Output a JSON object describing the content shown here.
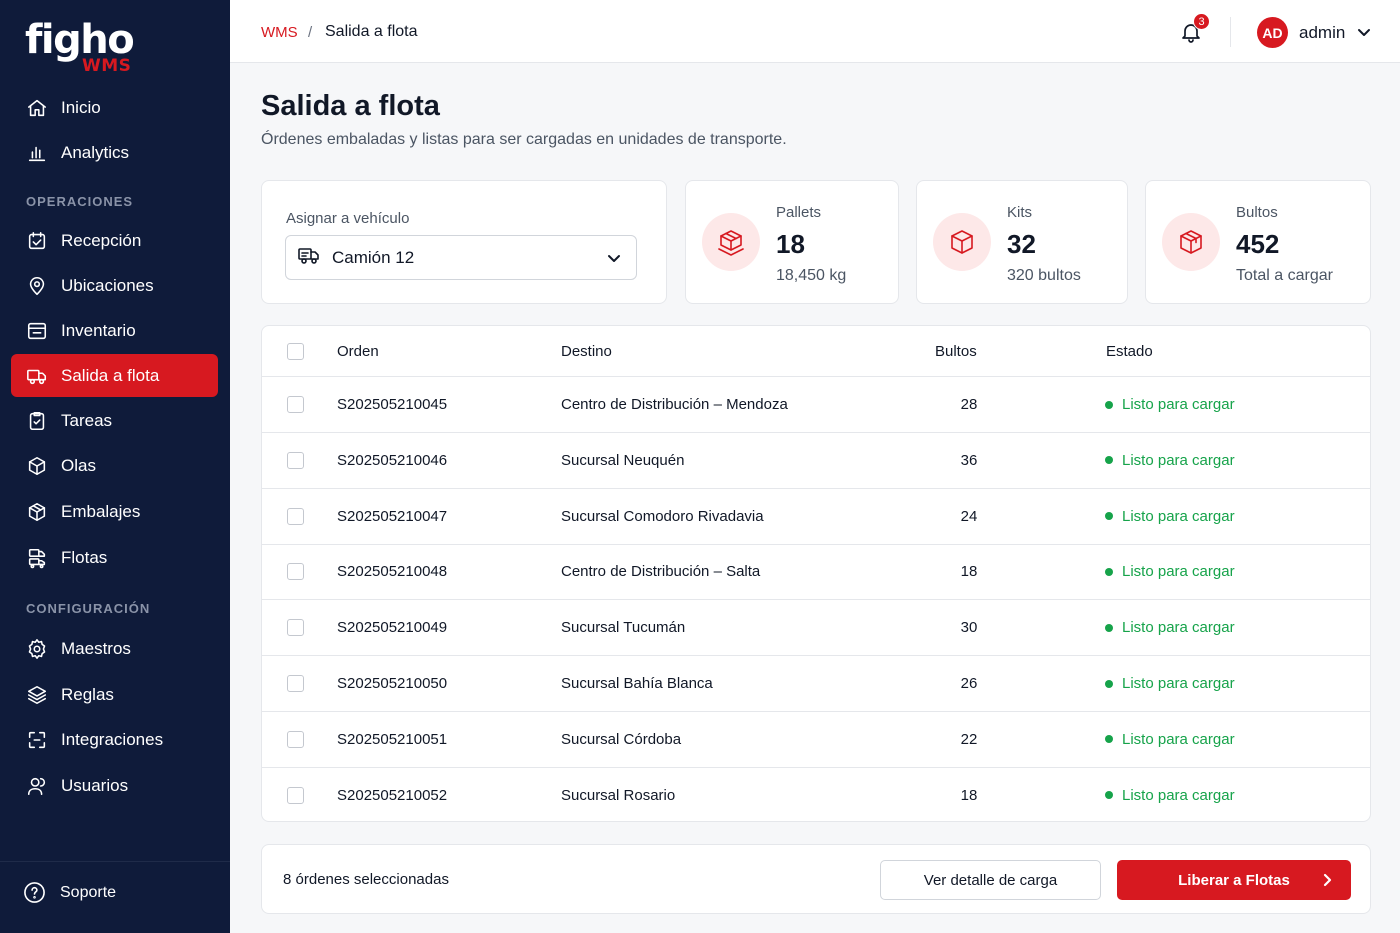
{
  "brand": {
    "name": "figho",
    "sub": "WMS",
    "accent": "#d71920",
    "sidebar_bg": "#0f1b3a"
  },
  "sidebar": {
    "top_items": [
      {
        "label": "Inicio",
        "icon": "home-icon"
      },
      {
        "label": "Analytics",
        "icon": "bar-chart-icon"
      }
    ],
    "sections": [
      {
        "title": "OPERACIONES",
        "items": [
          {
            "label": "Recepción",
            "icon": "receiving-icon"
          },
          {
            "label": "Ubicaciones",
            "icon": "map-pin-icon"
          },
          {
            "label": "Inventario",
            "icon": "inventory-icon"
          },
          {
            "label": "Salida a flota",
            "icon": "truck-icon",
            "active": true
          },
          {
            "label": "Tareas",
            "icon": "clipboard-check-icon"
          },
          {
            "label": "Olas",
            "icon": "box-icon"
          },
          {
            "label": "Embalajes",
            "icon": "package-icon"
          },
          {
            "label": "Flotas",
            "icon": "fleet-icon"
          }
        ]
      },
      {
        "title": "CONFIGURACIÓN",
        "items": [
          {
            "label": "Maestros",
            "icon": "gear-icon"
          },
          {
            "label": "Reglas",
            "icon": "rules-icon"
          },
          {
            "label": "Integraciones",
            "icon": "integrations-icon"
          },
          {
            "label": "Usuarios",
            "icon": "users-icon"
          }
        ]
      }
    ],
    "support": {
      "label": "Soporte",
      "icon": "help-circle-icon"
    }
  },
  "topbar": {
    "breadcrumb": {
      "root": "WMS",
      "separator": "/",
      "current": "Salida a flota"
    },
    "notifications_count": "3",
    "user": {
      "initials": "AD",
      "name": "admin"
    }
  },
  "header": {
    "title": "Salida a flota",
    "subtitle": "Órdenes embaladas y listas para ser cargadas en unidades de transporte."
  },
  "assign": {
    "label": "Asignar a vehículo",
    "selected": "Camión 12"
  },
  "stats": [
    {
      "label": "Pallets",
      "value": "18",
      "sub": "18,450 kg",
      "icon": "pallet-icon"
    },
    {
      "label": "Kits",
      "value": "32",
      "sub": "320 bultos",
      "icon": "box-icon"
    },
    {
      "label": "Bultos",
      "value": "452",
      "sub": "Total a cargar",
      "icon": "package-icon"
    }
  ],
  "table": {
    "columns": [
      "Orden",
      "Destino",
      "Bultos",
      "Estado"
    ],
    "rows": [
      {
        "order": "S202505210045",
        "dest": "Centro de Distribución – Mendoza",
        "bultos": "28",
        "status": "Listo para cargar"
      },
      {
        "order": "S202505210046",
        "dest": "Sucursal Neuquén",
        "bultos": "36",
        "status": "Listo para cargar"
      },
      {
        "order": "S202505210047",
        "dest": "Sucursal Comodoro Rivadavia",
        "bultos": "24",
        "status": "Listo para cargar"
      },
      {
        "order": "S202505210048",
        "dest": "Centro de Distribución – Salta",
        "bultos": "18",
        "status": "Listo para cargar"
      },
      {
        "order": "S202505210049",
        "dest": "Sucursal Tucumán",
        "bultos": "30",
        "status": "Listo para cargar"
      },
      {
        "order": "S202505210050",
        "dest": "Sucursal Bahía Blanca",
        "bultos": "26",
        "status": "Listo para cargar"
      },
      {
        "order": "S202505210051",
        "dest": "Sucursal Córdoba",
        "bultos": "22",
        "status": "Listo para cargar"
      },
      {
        "order": "S202505210052",
        "dest": "Sucursal Rosario",
        "bultos": "18",
        "status": "Listo para cargar"
      }
    ],
    "status_color": "#16a34a"
  },
  "footer": {
    "selected_text": "8 órdenes seleccionadas",
    "secondary_button": "Ver detalle de carga",
    "primary_button": "Liberar a Flotas"
  }
}
